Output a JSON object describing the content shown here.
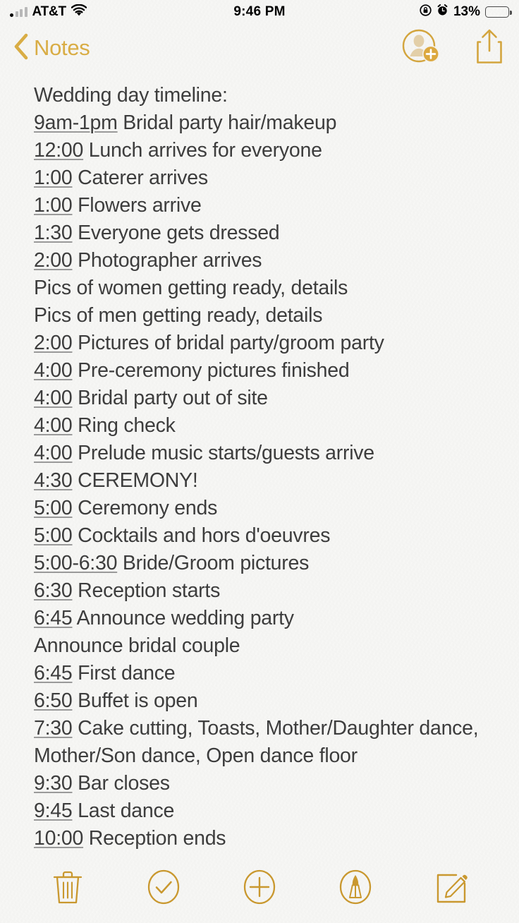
{
  "status_bar": {
    "carrier": "AT&T",
    "time": "9:46 PM",
    "battery_percent": "13%",
    "battery_level": 13,
    "signal_bars_filled": 1,
    "icons": [
      "signal-bars-icon",
      "wifi-icon",
      "rotation-lock-icon",
      "alarm-clock-icon",
      "battery-icon"
    ]
  },
  "nav_bar": {
    "back_label": "Notes",
    "back_icon": "chevron-left-icon",
    "actions": [
      {
        "name": "add-collaborator-button",
        "icon": "person-add-icon"
      },
      {
        "name": "share-button",
        "icon": "share-icon"
      }
    ]
  },
  "note": {
    "lines": [
      {
        "time": "",
        "text": "Wedding day timeline:"
      },
      {
        "time": "9am-1pm",
        "text": " Bridal party hair/makeup"
      },
      {
        "time": "12:00",
        "text": " Lunch arrives for everyone"
      },
      {
        "time": "1:00",
        "text": " Caterer arrives"
      },
      {
        "time": "1:00",
        "text": " Flowers arrive"
      },
      {
        "time": "1:30",
        "text": " Everyone gets dressed"
      },
      {
        "time": "2:00",
        "text": " Photographer arrives"
      },
      {
        "time": "",
        "text": "Pics of women getting ready, details"
      },
      {
        "time": "",
        "text": "Pics of men getting ready, details"
      },
      {
        "time": "2:00",
        "text": " Pictures of bridal party/groom party"
      },
      {
        "time": "4:00",
        "text": " Pre-ceremony pictures finished"
      },
      {
        "time": "4:00",
        "text": " Bridal party out of site"
      },
      {
        "time": "4:00",
        "text": " Ring check"
      },
      {
        "time": "4:00",
        "text": " Prelude music starts/guests arrive"
      },
      {
        "time": "4:30",
        "text": " CEREMONY!"
      },
      {
        "time": "5:00",
        "text": " Ceremony ends"
      },
      {
        "time": "5:00",
        "text": " Cocktails and hors d'oeuvres"
      },
      {
        "time": "5:00-6:30",
        "text": " Bride/Groom pictures"
      },
      {
        "time": "6:30",
        "text": " Reception starts"
      },
      {
        "time": "6:45",
        "text": " Announce wedding party"
      },
      {
        "time": "",
        "text": "Announce bridal couple"
      },
      {
        "time": "6:45",
        "text": " First dance"
      },
      {
        "time": "6:50",
        "text": " Buffet is open"
      },
      {
        "time": "7:30",
        "text": " Cake cutting, Toasts, Mother/Daughter dance, Mother/Son dance, Open dance floor"
      },
      {
        "time": "9:30",
        "text": " Bar closes"
      },
      {
        "time": "9:45",
        "text": " Last dance"
      },
      {
        "time": "10:00",
        "text": " Reception ends"
      }
    ]
  },
  "toolbar": {
    "buttons": [
      {
        "name": "delete-button",
        "icon": "trash-icon"
      },
      {
        "name": "checklist-button",
        "icon": "check-circle-icon"
      },
      {
        "name": "add-attachment-button",
        "icon": "plus-circle-icon"
      },
      {
        "name": "markup-button",
        "icon": "pen-circle-icon"
      },
      {
        "name": "compose-button",
        "icon": "compose-icon"
      }
    ]
  },
  "colors": {
    "accent_gold": "#d9ad45",
    "text": "#3d3d3d",
    "background": "#f7f7f5",
    "battery_fill": "#f0b429"
  }
}
